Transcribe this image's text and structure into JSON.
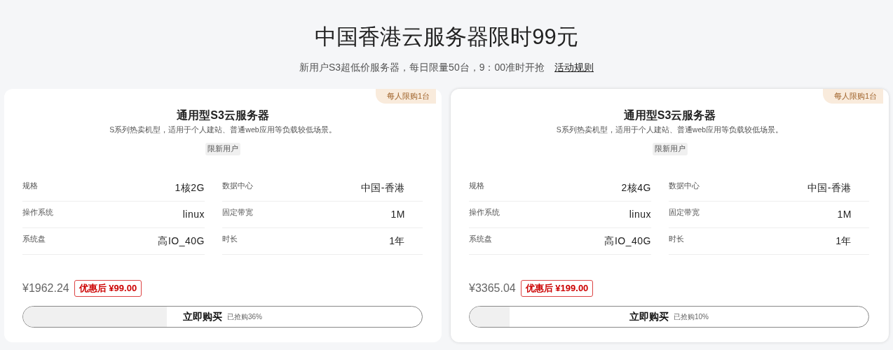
{
  "header": {
    "title": "中国香港云服务器限时99元",
    "subtitle": "新用户S3超低价服务器，每日限量50台，9：00准时开抢",
    "rules_link": "活动规则"
  },
  "products": [
    {
      "corner_tag": "每人限购1台",
      "name": "通用型S3云服务器",
      "description": "S系列热卖机型，适用于个人建站、普通web应用等负载较低场景。",
      "tag": "限新用户",
      "specs": [
        {
          "label": "规格",
          "value": "1核2G"
        },
        {
          "label": "数据中心",
          "value": "中国-香港"
        },
        {
          "label": "操作系统",
          "value": "linux"
        },
        {
          "label": "固定带宽",
          "value": "1M"
        },
        {
          "label": "系统盘",
          "value": "高IO_40G"
        },
        {
          "label": "时长",
          "value": "1年"
        }
      ],
      "original_price": "¥1962.24",
      "discount_price": "优惠后 ¥99.00",
      "buy_button": "立即购买",
      "sold": "已抢购36%",
      "level": 0.36
    },
    {
      "corner_tag": "每人限购1台",
      "name": "通用型S3云服务器",
      "description": "S系列热卖机型，适用于个人建站、普通web应用等负载较低场景。",
      "tag": "限新用户",
      "specs": [
        {
          "label": "规格",
          "value": "2核4G"
        },
        {
          "label": "数据中心",
          "value": "中国-香港"
        },
        {
          "label": "操作系统",
          "value": "linux"
        },
        {
          "label": "固定带宽",
          "value": "1M"
        },
        {
          "label": "系统盘",
          "value": "高IO_40G"
        },
        {
          "label": "时长",
          "value": "1年"
        }
      ],
      "original_price": "¥3365.04",
      "discount_price": "优惠后 ¥199.00",
      "buy_button": "立即购买",
      "sold": "已抢购10%",
      "level": 0.1
    }
  ]
}
